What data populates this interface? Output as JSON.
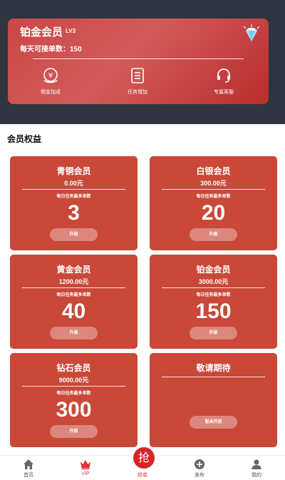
{
  "member_card": {
    "title": "铂金会员",
    "level": "LV3",
    "daily_orders": "每天可接单数：150",
    "features": [
      {
        "label": "佣金加成",
        "icon": "commission-icon"
      },
      {
        "label": "任务增加",
        "icon": "task-list-icon"
      },
      {
        "label": "专属客服",
        "icon": "headset-icon"
      }
    ]
  },
  "section_title": "会员权益",
  "tiers": [
    {
      "name": "青铜会员",
      "price": "0.00元",
      "caption": "每日任务最多单数",
      "orders": "3",
      "button": "升级"
    },
    {
      "name": "白银会员",
      "price": "300.00元",
      "caption": "每日任务最多单数",
      "orders": "20",
      "button": "升级"
    },
    {
      "name": "黄金会员",
      "price": "1200.00元",
      "caption": "每日任务最多单数",
      "orders": "40",
      "button": "升级"
    },
    {
      "name": "铂金会员",
      "price": "3000.00元",
      "caption": "每日任务最多单数",
      "orders": "150",
      "button": "升级"
    },
    {
      "name": "钻石会员",
      "price": "9000.00元",
      "caption": "每日任务最多单数",
      "orders": "300",
      "button": "升级"
    }
  ],
  "coming_soon": {
    "title": "敬请期待",
    "button": "暂未开放"
  },
  "tabbar": {
    "grab_label": "抢",
    "items": [
      {
        "label": "首页",
        "icon": "home-icon"
      },
      {
        "label": "VIP",
        "icon": "crown-icon",
        "active": true
      },
      {
        "label": "抢单",
        "icon": "grab-icon",
        "active": true
      },
      {
        "label": "发布",
        "icon": "plus-circle-icon"
      },
      {
        "label": "我的",
        "icon": "person-icon"
      }
    ]
  },
  "colors": {
    "header_bg": "#2f3440",
    "card_red": "#c94838",
    "accent_red": "#e03535"
  }
}
